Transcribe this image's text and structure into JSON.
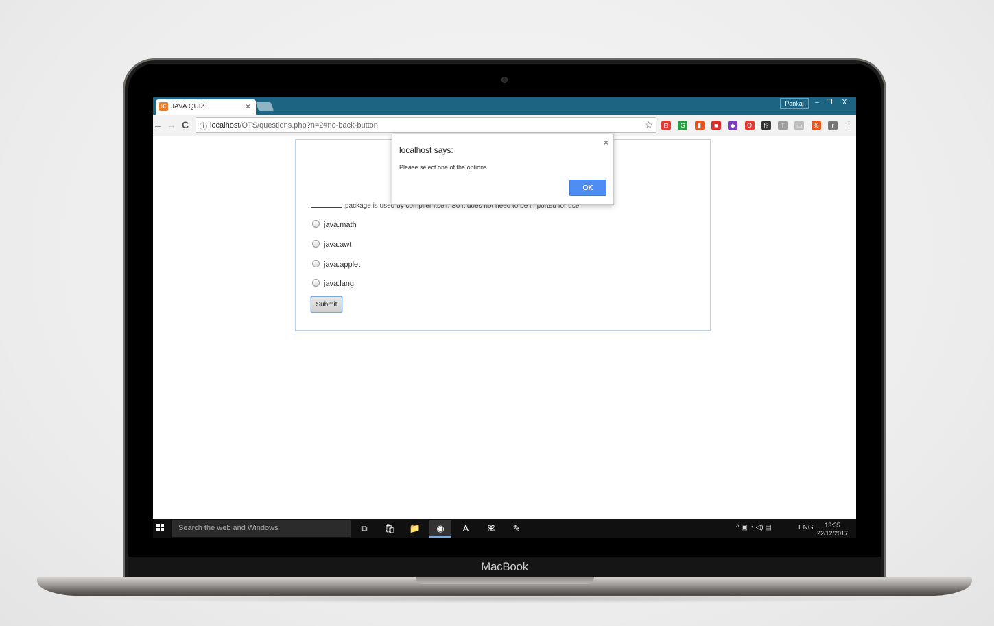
{
  "device": {
    "brand_label": "MacBook"
  },
  "browser": {
    "tab_title": "JAVA QUIZ",
    "tab_close": "×",
    "user_badge": "Pankaj",
    "window_controls": {
      "minimize": "–",
      "restore": "❐",
      "close": "X"
    },
    "nav": {
      "back": "←",
      "forward": "→",
      "reload": "C"
    },
    "address": {
      "info_icon": "ⓘ",
      "host": "localhost",
      "path": "/OTS/questions.php?n=2#no-back-button",
      "star": "☆"
    },
    "extension_icons": [
      {
        "name": "ext-red-icon",
        "color": "#e53935",
        "glyph": "⊡"
      },
      {
        "name": "ext-green-icon",
        "color": "#2e9b47",
        "glyph": "G"
      },
      {
        "name": "ext-office-icon",
        "color": "#e8541e",
        "glyph": "▮"
      },
      {
        "name": "ext-bookmark-icon",
        "color": "#d32f2f",
        "glyph": "■"
      },
      {
        "name": "ext-color-icon",
        "color": "#7b3fbf",
        "glyph": "◆"
      },
      {
        "name": "ext-opera-icon",
        "color": "#e53935",
        "glyph": "O"
      },
      {
        "name": "ext-font-icon",
        "color": "#333333",
        "glyph": "f?"
      },
      {
        "name": "ext-text-icon",
        "color": "#9e9e9e",
        "glyph": "T"
      },
      {
        "name": "ext-calendar-icon",
        "color": "#bdbdbd",
        "glyph": "▭"
      },
      {
        "name": "ext-percent-icon",
        "color": "#e8541e",
        "glyph": "%"
      },
      {
        "name": "ext-r-icon",
        "color": "#777777",
        "glyph": "r"
      }
    ],
    "menu": "⋮"
  },
  "quiz": {
    "question": "package is used by compiler itself. So it does not need to be imported for use.",
    "options": [
      "java.math",
      "java.awt",
      "java.applet",
      "java.lang"
    ],
    "submit_label": "Submit"
  },
  "alert": {
    "title": "localhost says:",
    "message": "Please select one of the options.",
    "close": "×",
    "ok_label": "OK"
  },
  "taskbar": {
    "search_placeholder": "Search the web and Windows",
    "apps": [
      {
        "name": "task-view-icon",
        "glyph": "⧉"
      },
      {
        "name": "store-icon",
        "glyph": "🛍"
      },
      {
        "name": "file-explorer-icon",
        "glyph": "📁"
      },
      {
        "name": "chrome-icon",
        "glyph": "◉"
      },
      {
        "name": "acrobat-icon",
        "glyph": "A"
      },
      {
        "name": "xampp-icon",
        "glyph": "ꕤ"
      },
      {
        "name": "notepad-plus-icon",
        "glyph": "✎"
      }
    ],
    "tray": {
      "icons": "^ ▣ ◔ ◁) ▤",
      "language": "ENG"
    },
    "time": "13:35",
    "date": "22/12/2017"
  }
}
